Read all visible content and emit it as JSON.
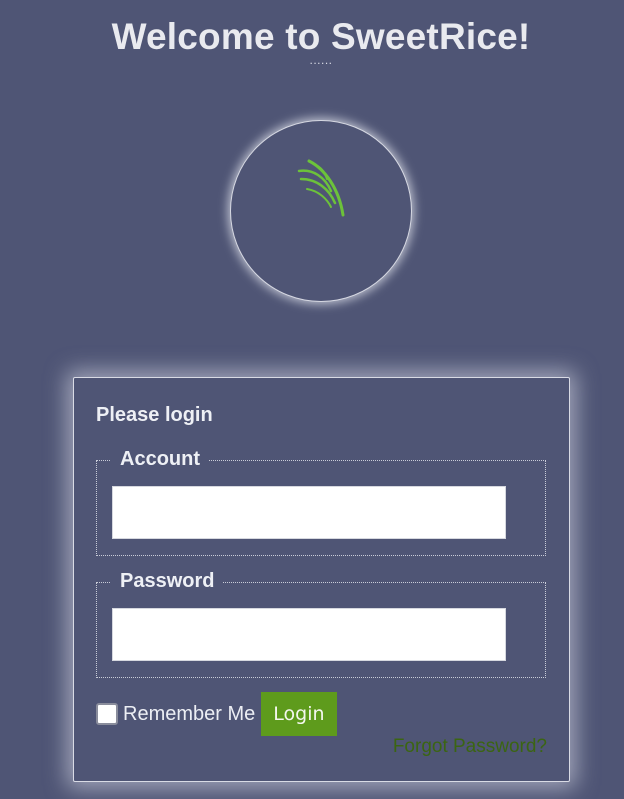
{
  "header": {
    "title": "Welcome to SweetRice!",
    "dots": "......"
  },
  "logo": {
    "icon": "rice-stalk-icon",
    "color": "#6cc23a"
  },
  "login": {
    "heading": "Please login",
    "account": {
      "legend": "Account",
      "value": "",
      "placeholder": ""
    },
    "password": {
      "legend": "Password",
      "value": "",
      "placeholder": ""
    },
    "remember_label": "Remember Me",
    "remember_checked": false,
    "login_button": "Login",
    "forgot_link": "Forgot Password?"
  },
  "colors": {
    "background": "#4f5575",
    "button": "#5e9b1c",
    "link": "#3b6512"
  }
}
